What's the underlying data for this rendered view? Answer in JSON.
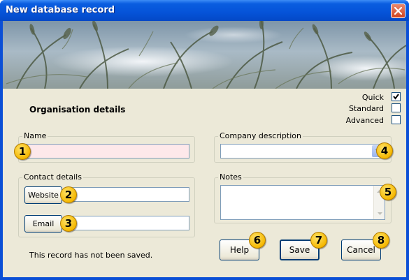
{
  "window": {
    "title": "New database record"
  },
  "form": {
    "heading": "Organisation details",
    "status": "This record has not been saved."
  },
  "modes": [
    {
      "label": "Quick",
      "checked": true
    },
    {
      "label": "Standard",
      "checked": false
    },
    {
      "label": "Advanced",
      "checked": false
    }
  ],
  "name_group": {
    "legend": "Name",
    "value": ""
  },
  "contact_group": {
    "legend": "Contact details",
    "website_button": "Website",
    "website_value": "",
    "email_button": "Email",
    "email_value": ""
  },
  "company_group": {
    "legend": "Company description",
    "selected": ""
  },
  "notes_group": {
    "legend": "Notes",
    "value": ""
  },
  "buttons": {
    "help": "Help",
    "save": "Save",
    "cancel": "Cancel"
  },
  "callouts": [
    "1",
    "2",
    "3",
    "4",
    "5",
    "6",
    "7",
    "8"
  ],
  "colors": {
    "title_bar": "#0553d8",
    "dialog_background": "#ece9d8",
    "required_field": "#fde8ea",
    "callout": "#f5b800"
  }
}
